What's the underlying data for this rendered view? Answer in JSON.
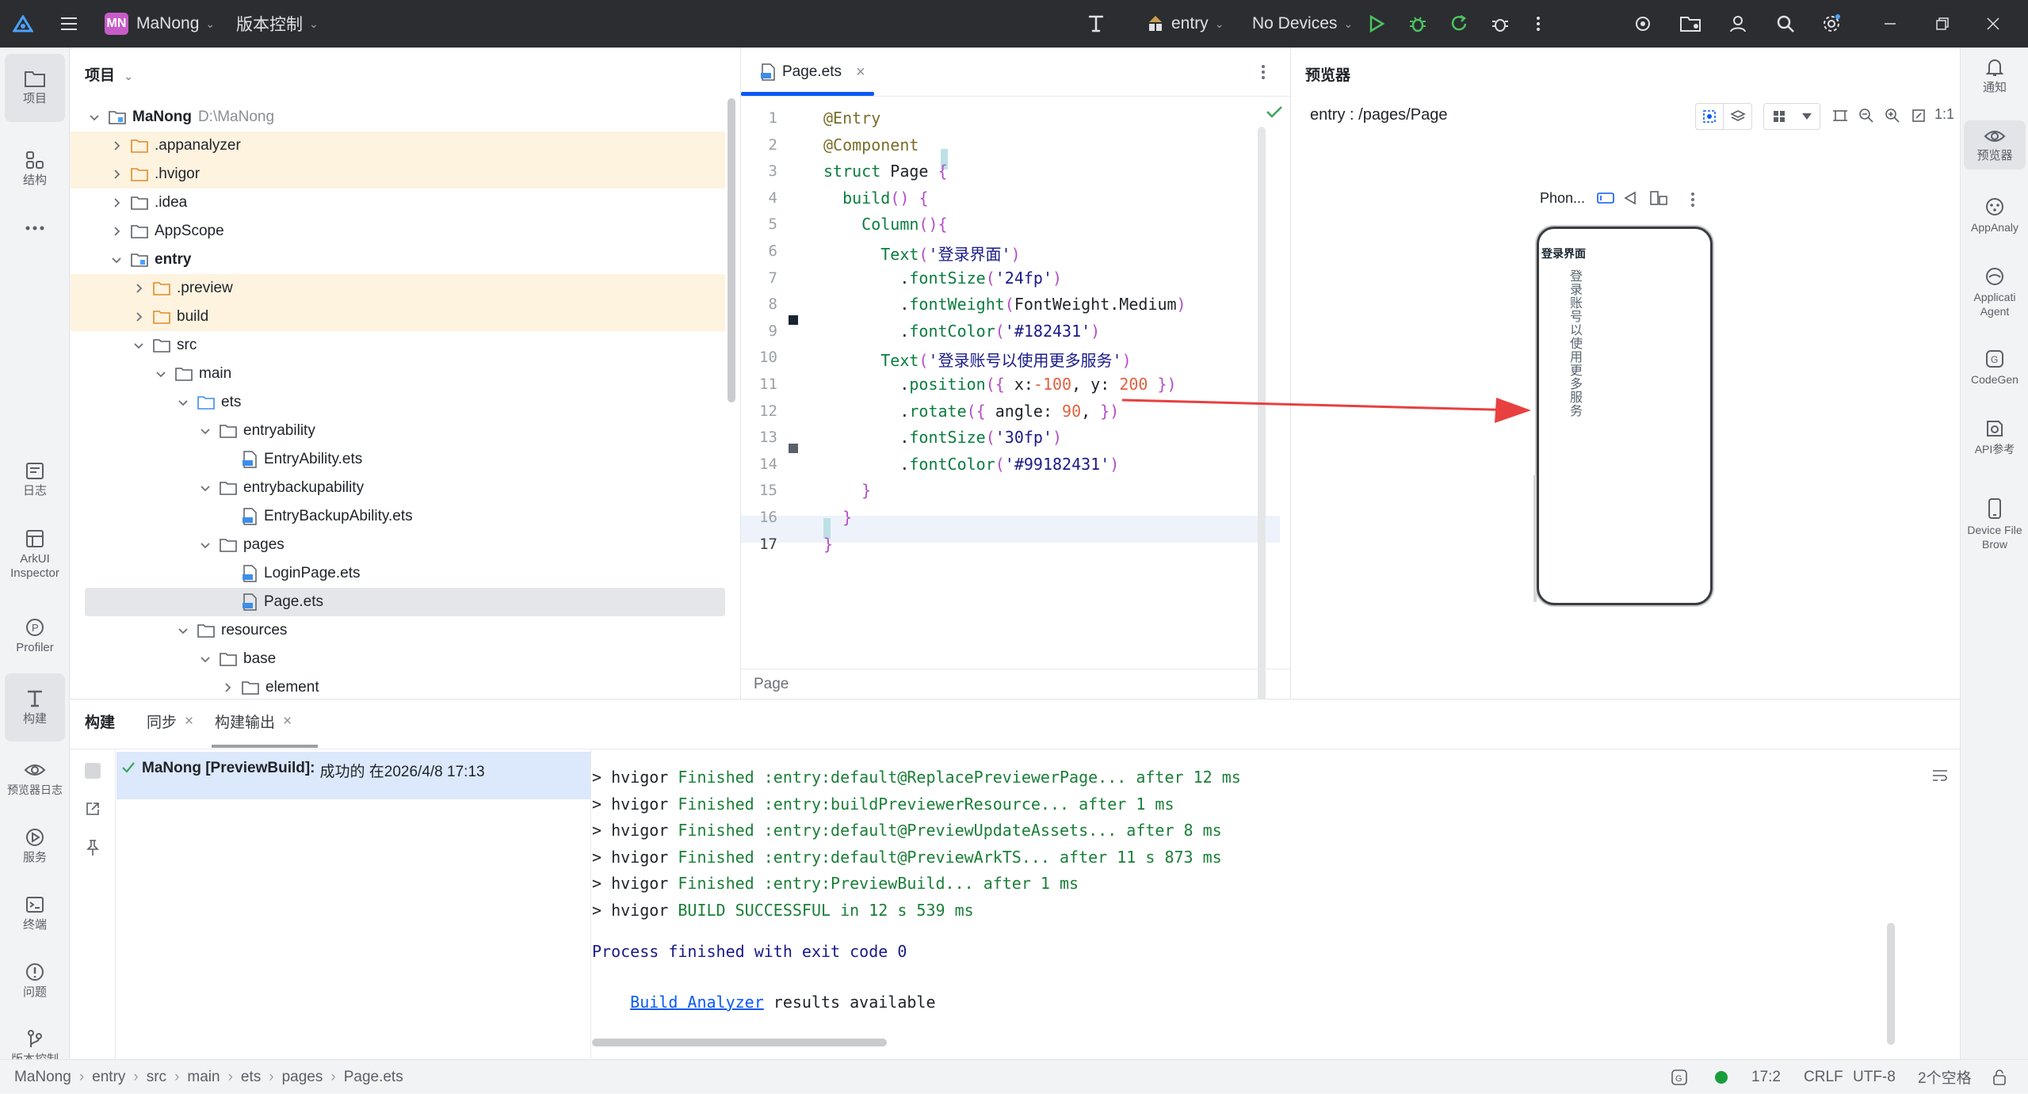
{
  "titlebar": {
    "project_badge": "MN",
    "project_name": "MaNong",
    "vcs_menu": "版本控制",
    "module_select": "entry",
    "device_select": "No Devices"
  },
  "left_tools": [
    {
      "id": "project",
      "label": "项目"
    },
    {
      "id": "structure",
      "label": "结构"
    },
    {
      "id": "log",
      "label": "日志"
    },
    {
      "id": "arkui",
      "label": "ArkUI Inspector"
    },
    {
      "id": "profiler",
      "label": "Profiler"
    },
    {
      "id": "build",
      "label": "构建"
    },
    {
      "id": "preview-log",
      "label": "预览器日志"
    },
    {
      "id": "services",
      "label": "服务"
    },
    {
      "id": "terminal",
      "label": "终端"
    },
    {
      "id": "problems",
      "label": "问题"
    },
    {
      "id": "vcs",
      "label": "版本控制"
    }
  ],
  "right_tools": [
    {
      "label": "通知"
    },
    {
      "label": "预览器"
    },
    {
      "label": "AppAnaly"
    },
    {
      "label": "Applicati Agent"
    },
    {
      "label": "CodeGen"
    },
    {
      "label": "API参考"
    },
    {
      "label": "Device File Brow"
    }
  ],
  "project_panel": {
    "title": "项目",
    "root_name": "MaNong",
    "root_path": "D:\\MaNong",
    "items": [
      {
        "name": ".appanalyzer"
      },
      {
        "name": ".hvigor"
      },
      {
        "name": ".idea"
      },
      {
        "name": "AppScope"
      },
      {
        "name": "entry"
      },
      {
        "name": ".preview"
      },
      {
        "name": "build"
      },
      {
        "name": "src"
      },
      {
        "name": "main"
      },
      {
        "name": "ets"
      },
      {
        "name": "entryability"
      },
      {
        "name": "EntryAbility.ets"
      },
      {
        "name": "entrybackupability"
      },
      {
        "name": "EntryBackupAbility.ets"
      },
      {
        "name": "pages"
      },
      {
        "name": "LoginPage.ets"
      },
      {
        "name": "Page.ets"
      },
      {
        "name": "resources"
      },
      {
        "name": "base"
      },
      {
        "name": "element"
      }
    ]
  },
  "editor": {
    "tab_label": "Page.ets",
    "breadcrumb": "Page",
    "line_numbers": [
      "1",
      "2",
      "3",
      "4",
      "5",
      "6",
      "7",
      "8",
      "9",
      "10",
      "11",
      "12",
      "13",
      "14",
      "15",
      "16",
      "17"
    ],
    "lines": [
      "@Entry",
      "@Component",
      "struct Page {",
      "  build() {",
      "    Column(){",
      "      Text('登录界面')",
      "        .fontSize('24fp')",
      "        .fontWeight(FontWeight.Medium)",
      "        .fontColor('#182431')",
      "      Text('登录账号以使用更多服务')",
      "        .position({ x:-100, y: 200 })",
      "        .rotate({ angle: 90, })",
      "        .fontSize('30fp')",
      "        .fontColor('#99182431')",
      "    }",
      "  }",
      "}"
    ]
  },
  "preview_panel": {
    "title": "预览器",
    "route": "entry : /pages/Page",
    "zoom_label": "1:1",
    "device_label": "Phon...",
    "phone_title": "登录界面",
    "phone_rotated_text": "登录账号以使用更多服务"
  },
  "build_panel": {
    "tabs": [
      "构建",
      "同步",
      "构建输出"
    ],
    "task_project": "MaNong [PreviewBuild]:",
    "task_result": "成功的 在2026/4/8 17:13",
    "log_lines": [
      {
        "prefix": "> hvigor ",
        "body": "Finished :entry:default@ReplacePreviewerPage... after 12 ms"
      },
      {
        "prefix": "> hvigor ",
        "body": "Finished :entry:buildPreviewerResource... after 1 ms"
      },
      {
        "prefix": "> hvigor ",
        "body": "Finished :entry:default@PreviewUpdateAssets... after 8 ms"
      },
      {
        "prefix": "> hvigor ",
        "body": "Finished :entry:default@PreviewArkTS... after 11 s 873 ms"
      },
      {
        "prefix": "> hvigor ",
        "body": "Finished :entry:PreviewBuild... after 1 ms"
      },
      {
        "prefix": "> hvigor ",
        "body": "BUILD SUCCESSFUL in 12 s 539 ms"
      }
    ],
    "process_line": "Process finished with exit code 0",
    "analyzer_link": "Build Analyzer",
    "analyzer_suffix": " results available"
  },
  "statusbar": {
    "crumbs": [
      "MaNong",
      "entry",
      "src",
      "main",
      "ets",
      "pages",
      "Page.ets"
    ],
    "position": "17:2",
    "line_sep": "CRLF",
    "encoding": "UTF-8",
    "indent": "2个空格"
  },
  "colors": {
    "accent": "#0a59f7",
    "titlebar_bg": "#2b2d30",
    "success": "#1a7f37",
    "arrow": "#e84040",
    "highlight_row": "#fdf3df"
  }
}
